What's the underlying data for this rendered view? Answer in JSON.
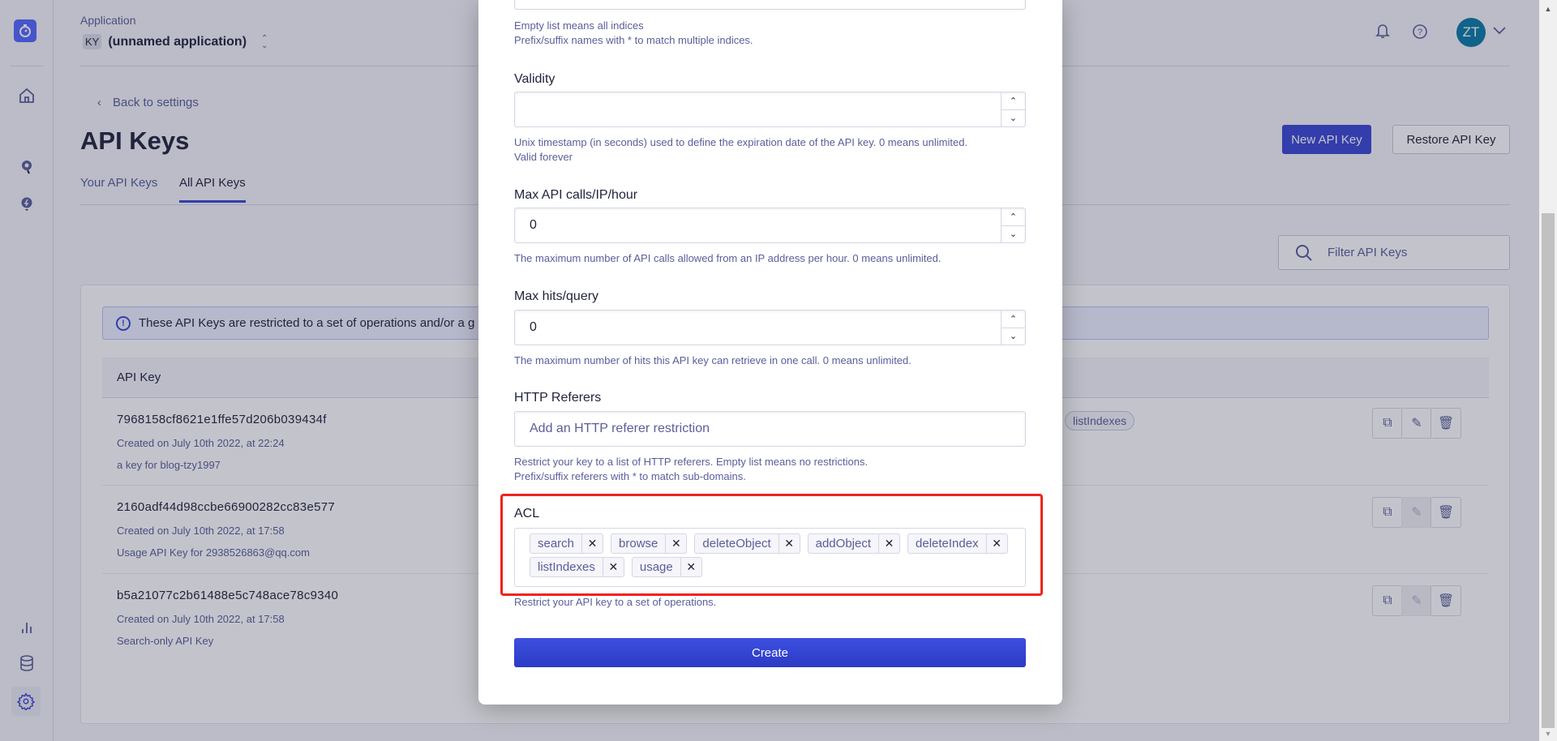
{
  "sidebar": {
    "items": [
      {
        "icon": "home-icon"
      },
      {
        "icon": "search-icon"
      },
      {
        "icon": "bolt-bulb-icon"
      },
      {
        "icon": "chart-icon"
      },
      {
        "icon": "database-icon"
      },
      {
        "icon": "gear-icon",
        "active": true
      }
    ]
  },
  "header": {
    "app_label": "Application",
    "app_badge": "KY",
    "app_name": "(unnamed application)",
    "avatar": "ZT"
  },
  "page": {
    "back": "Back to settings",
    "title": "API Keys",
    "tabs": [
      {
        "label": "Your API Keys"
      },
      {
        "label": "All API Keys",
        "active": true
      }
    ],
    "new_key": "New API Key",
    "restore_key": "Restore API Key",
    "filter_placeholder": "Filter API Keys"
  },
  "table": {
    "banner": "These API Keys are restricted to a set of operations and/or a g",
    "header": "API Key",
    "rows": [
      {
        "key": "7968158cf8621e1ffe57d206b039434f",
        "created": "Created on July 10th 2022, at 22:24",
        "desc": "a key for blog-tzy1997",
        "acl_visible": "listIndexes",
        "editable": true
      },
      {
        "key": "2160adf44d98ccbe66900282cc83e577",
        "created": "Created on July 10th 2022, at 17:58",
        "desc": "Usage API Key for 2938526863@qq.com",
        "editable": false
      },
      {
        "key": "b5a21077c2b61488e5c748ace78c9340",
        "created": "Created on July 10th 2022, at 17:58",
        "desc": "Search-only API Key",
        "editable": false
      }
    ]
  },
  "modal": {
    "indices_hint1": "Empty list means all indices",
    "indices_hint2": "Prefix/suffix names with * to match multiple indices.",
    "validity": {
      "label": "Validity",
      "value": "",
      "hint1": "Unix timestamp (in seconds) used to define the expiration date of the API key. 0 means unlimited.",
      "hint2": "Valid forever"
    },
    "max_calls": {
      "label": "Max API calls/IP/hour",
      "value": "0",
      "hint": "The maximum number of API calls allowed from an IP address per hour. 0 means unlimited."
    },
    "max_hits": {
      "label": "Max hits/query",
      "value": "0",
      "hint": "The maximum number of hits this API key can retrieve in one call. 0 means unlimited."
    },
    "referers": {
      "label": "HTTP Referers",
      "placeholder": "Add an HTTP referer restriction",
      "hint1": "Restrict your key to a list of HTTP referers. Empty list means no restrictions.",
      "hint2": "Prefix/suffix referers with * to match sub-domains."
    },
    "acl": {
      "label": "ACL",
      "items": [
        "search",
        "browse",
        "deleteObject",
        "addObject",
        "deleteIndex",
        "listIndexes",
        "usage"
      ],
      "hint": "Restrict your API key to a set of operations."
    },
    "create": "Create"
  },
  "colors": {
    "primary": "#3a46d4",
    "highlight": "#f0231e",
    "avatar": "#0a7aa6"
  }
}
